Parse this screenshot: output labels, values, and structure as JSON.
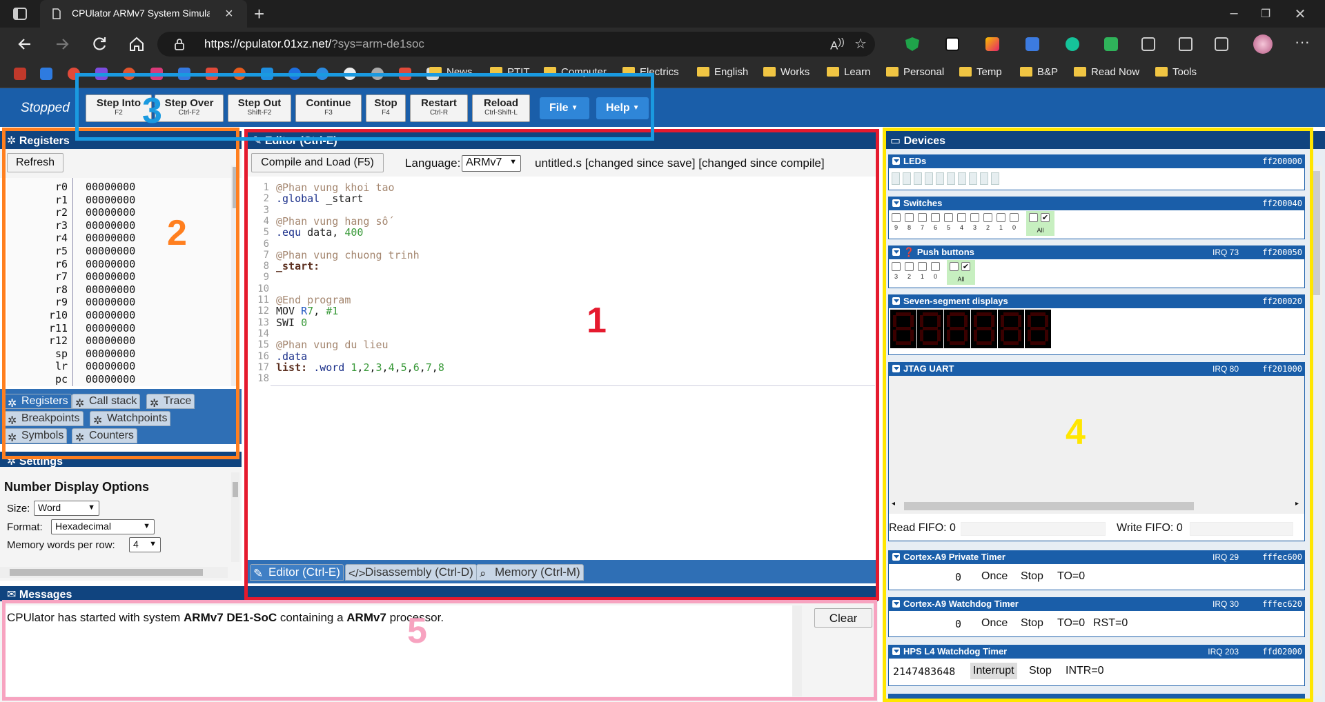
{
  "browser": {
    "tab_title": "CPUlator ARMv7 System Simulat",
    "url_host": "https://cpulator.01xz.net/",
    "url_query": "?sys=arm-de1soc",
    "bookmarks": [
      "News",
      "PTIT",
      "Computer",
      "Electrics",
      "English",
      "Works",
      "Learn",
      "Personal",
      "Temp",
      "B&P",
      "Read Now",
      "Tools"
    ]
  },
  "toolbar": {
    "status": "Stopped",
    "buttons": [
      {
        "label": "Step Into",
        "key": "F2"
      },
      {
        "label": "Step Over",
        "key": "Ctrl-F2"
      },
      {
        "label": "Step Out",
        "key": "Shift-F2"
      },
      {
        "label": "Continue",
        "key": "F3"
      },
      {
        "label": "Stop",
        "key": "F4"
      },
      {
        "label": "Restart",
        "key": "Ctrl-R"
      },
      {
        "label": "Reload",
        "key": "Ctrl-Shift-L"
      }
    ],
    "file_menu": "File",
    "help_menu": "Help"
  },
  "registers": {
    "title": "Registers",
    "refresh": "Refresh",
    "rows": [
      {
        "name": "r0",
        "value": "00000000"
      },
      {
        "name": "r1",
        "value": "00000000"
      },
      {
        "name": "r2",
        "value": "00000000"
      },
      {
        "name": "r3",
        "value": "00000000"
      },
      {
        "name": "r4",
        "value": "00000000"
      },
      {
        "name": "r5",
        "value": "00000000"
      },
      {
        "name": "r6",
        "value": "00000000"
      },
      {
        "name": "r7",
        "value": "00000000"
      },
      {
        "name": "r8",
        "value": "00000000"
      },
      {
        "name": "r9",
        "value": "00000000"
      },
      {
        "name": "r10",
        "value": "00000000"
      },
      {
        "name": "r11",
        "value": "00000000"
      },
      {
        "name": "r12",
        "value": "00000000"
      },
      {
        "name": "sp",
        "value": "00000000"
      },
      {
        "name": "lr",
        "value": "00000000"
      },
      {
        "name": "pc",
        "value": "00000000"
      }
    ],
    "tabs": [
      "Registers",
      "Call stack",
      "Trace",
      "Breakpoints",
      "Watchpoints",
      "Symbols",
      "Counters"
    ]
  },
  "settings": {
    "title": "Settings",
    "heading": "Number Display Options",
    "size_label": "Size:",
    "size_value": "Word",
    "format_label": "Format:",
    "format_value": "Hexadecimal",
    "mem_label": "Memory words per row:",
    "mem_value": "4"
  },
  "editor": {
    "title": "Editor (Ctrl-E)",
    "compile": "Compile and Load (F5)",
    "language_label": "Language:",
    "language_value": "ARMv7",
    "file_status": "untitled.s [changed since save] [changed since compile]",
    "code_lines": [
      "@Phan vung khoi tao",
      ".global _start",
      "",
      "@Phan vung hang số",
      ".equ data, 400",
      "",
      "@Phan vung chuong trinh",
      "_start:",
      "",
      "",
      "@End program",
      "MOV R7, #1",
      "SWI 0",
      "",
      "@Phan vung du lieu",
      ".data",
      "list: .word 1,2,3,4,5,6,7,8",
      ""
    ],
    "tabs": [
      "Editor (Ctrl-E)",
      "Disassembly (Ctrl-D)",
      "Memory (Ctrl-M)"
    ]
  },
  "messages": {
    "title": "Messages",
    "text_1": "CPUlator has started with system ",
    "text_sys": "ARMv7 DE1-SoC",
    "text_2": " containing a ",
    "text_cpu": "ARMv7",
    "text_3": " processor.",
    "clear": "Clear"
  },
  "devices": {
    "title": "Devices",
    "leds": {
      "name": "LEDs",
      "addr": "ff200000"
    },
    "switches": {
      "name": "Switches",
      "addr": "ff200040",
      "labels": [
        "9",
        "8",
        "7",
        "6",
        "5",
        "4",
        "3",
        "2",
        "1",
        "0"
      ],
      "all": "All"
    },
    "buttons": {
      "name": "Push buttons",
      "irq": "IRQ 73",
      "addr": "ff200050",
      "labels": [
        "3",
        "2",
        "1",
        "0"
      ],
      "all": "All"
    },
    "seven_seg": {
      "name": "Seven-segment displays",
      "addr": "ff200020"
    },
    "uart": {
      "name": "JTAG UART",
      "irq": "IRQ 80",
      "addr": "ff201000",
      "read_fifo": "Read FIFO: 0",
      "write_fifo": "Write FIFO: 0"
    },
    "private_timer": {
      "name": "Cortex-A9 Private Timer",
      "irq": "IRQ 29",
      "addr": "fffec600",
      "value": "0",
      "mode": "Once",
      "stop": "Stop",
      "to": "TO=0"
    },
    "watchdog": {
      "name": "Cortex-A9 Watchdog Timer",
      "irq": "IRQ 30",
      "addr": "fffec620",
      "value": "0",
      "mode": "Once",
      "stop": "Stop",
      "to": "TO=0",
      "rst": "RST=0"
    },
    "hps_wd": {
      "name": "HPS L4 Watchdog Timer",
      "irq": "IRQ 203",
      "addr": "ffd02000",
      "value": "2147483648",
      "mode": "Interrupt",
      "stop": "Stop",
      "intr": "INTR=0"
    }
  },
  "overlays": {
    "n1": "1",
    "n2": "2",
    "n3": "3",
    "n4": "4",
    "n5": "5",
    "colors": {
      "editor": "#e51a2e",
      "registers": "#ff7f1f",
      "toolbar": "#1a9ae0",
      "devices": "#ffe600",
      "messages": "#f7a3c0"
    }
  }
}
